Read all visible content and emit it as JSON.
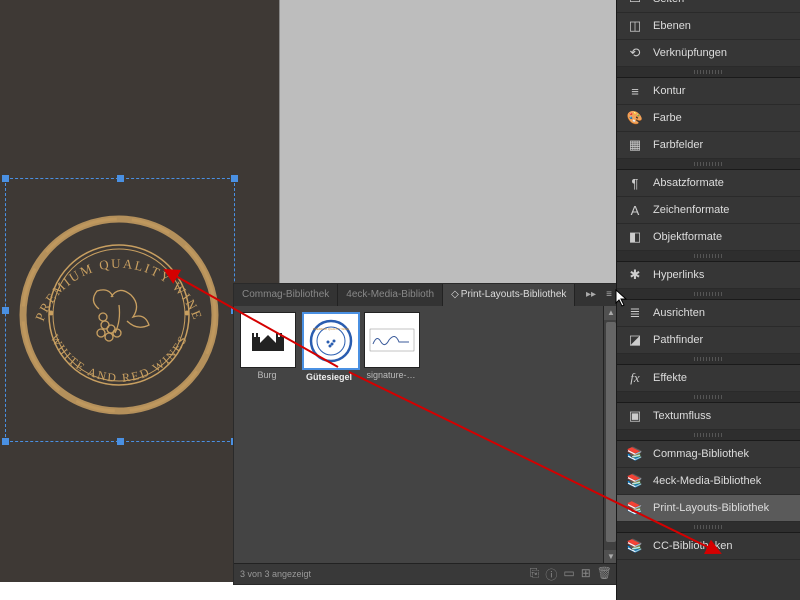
{
  "seal": {
    "top_text": "PREMIUM QUALITY WINE",
    "bottom_text": "WHITE AND RED WINES",
    "color": "#c9a061"
  },
  "library": {
    "tabs": [
      {
        "label": "Commag-Bibliothek",
        "active": false
      },
      {
        "label": "4eck-Media-Biblioth",
        "active": false
      },
      {
        "label": "Print-Layouts-Bibliothek",
        "active": true
      }
    ],
    "items": [
      {
        "label": "Burg",
        "selected": false,
        "thumb": "castle"
      },
      {
        "label": "Gütesiegel",
        "selected": true,
        "thumb": "seal"
      },
      {
        "label": "signature-…",
        "selected": false,
        "thumb": "signature"
      }
    ],
    "status": "3 von 3 angezeigt",
    "collapse": "▸▸",
    "menu": "≡"
  },
  "footer_icons": {
    "link": "⎘",
    "info": "ⓘ",
    "snippet": "▭",
    "new": "⊞",
    "trash": "🗑"
  },
  "right_panel": [
    {
      "type": "row",
      "icon": "seiten",
      "label": "Seiten"
    },
    {
      "type": "row",
      "icon": "ebenen",
      "label": "Ebenen"
    },
    {
      "type": "row",
      "icon": "links",
      "label": "Verknüpfungen"
    },
    {
      "type": "sep"
    },
    {
      "type": "row",
      "icon": "kontur",
      "label": "Kontur"
    },
    {
      "type": "row",
      "icon": "farbe",
      "label": "Farbe"
    },
    {
      "type": "row",
      "icon": "swatches",
      "label": "Farbfelder"
    },
    {
      "type": "sep"
    },
    {
      "type": "row",
      "icon": "para",
      "label": "Absatzformate"
    },
    {
      "type": "row",
      "icon": "char",
      "label": "Zeichenformate"
    },
    {
      "type": "row",
      "icon": "obj",
      "label": "Objektformate"
    },
    {
      "type": "sep"
    },
    {
      "type": "row",
      "icon": "hyper",
      "label": "Hyperlinks"
    },
    {
      "type": "sep"
    },
    {
      "type": "row",
      "icon": "align",
      "label": "Ausrichten"
    },
    {
      "type": "row",
      "icon": "pathfinder",
      "label": "Pathfinder"
    },
    {
      "type": "sep"
    },
    {
      "type": "row",
      "icon": "fx",
      "label": "Effekte"
    },
    {
      "type": "sep"
    },
    {
      "type": "row",
      "icon": "textwrap",
      "label": "Textumfluss"
    },
    {
      "type": "sep"
    },
    {
      "type": "row",
      "icon": "lib",
      "label": "Commag-Bibliothek"
    },
    {
      "type": "row",
      "icon": "lib",
      "label": "4eck-Media-Bibliothek"
    },
    {
      "type": "row",
      "icon": "lib",
      "label": "Print-Layouts-Bibliothek",
      "selected": true
    },
    {
      "type": "sep"
    },
    {
      "type": "row",
      "icon": "cclib",
      "label": "CC-Bibliotheken"
    }
  ],
  "icon_glyphs": {
    "seiten": "▭",
    "ebenen": "◫",
    "links": "⟲",
    "kontur": "≡",
    "farbe": "🎨",
    "swatches": "▦",
    "para": "¶",
    "char": "A",
    "obj": "◧",
    "hyper": "✱",
    "align": "≣",
    "pathfinder": "◪",
    "fx": "fx",
    "textwrap": "▣",
    "lib": "📚",
    "cclib": "📚"
  }
}
